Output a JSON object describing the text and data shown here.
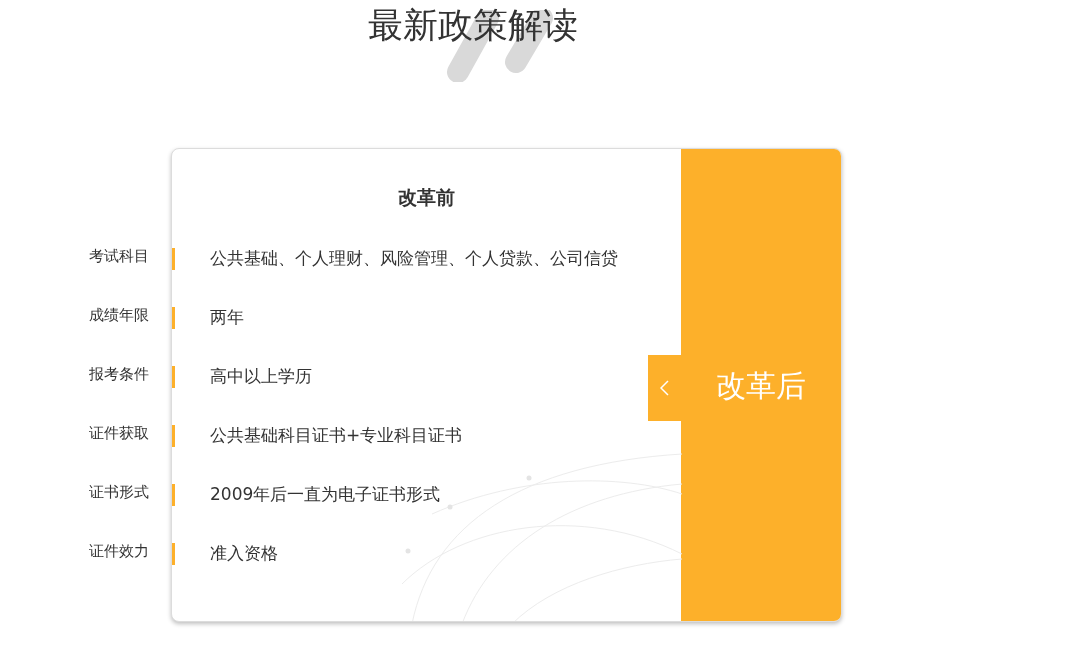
{
  "title": "最新政策解读",
  "comparison": {
    "before_heading": "改革前",
    "after_heading": "改革后",
    "rows": [
      {
        "label": "考试科目",
        "value": "公共基础、个人理财、风险管理、个人贷款、公司信贷"
      },
      {
        "label": "成绩年限",
        "value": "两年"
      },
      {
        "label": "报考条件",
        "value": "高中以上学历"
      },
      {
        "label": "证件获取",
        "value": "公共基础科目证书+专业科目证书"
      },
      {
        "label": "证书形式",
        "value": "2009年后一直为电子证书形式"
      },
      {
        "label": "证件效力",
        "value": "准入资格"
      }
    ]
  }
}
